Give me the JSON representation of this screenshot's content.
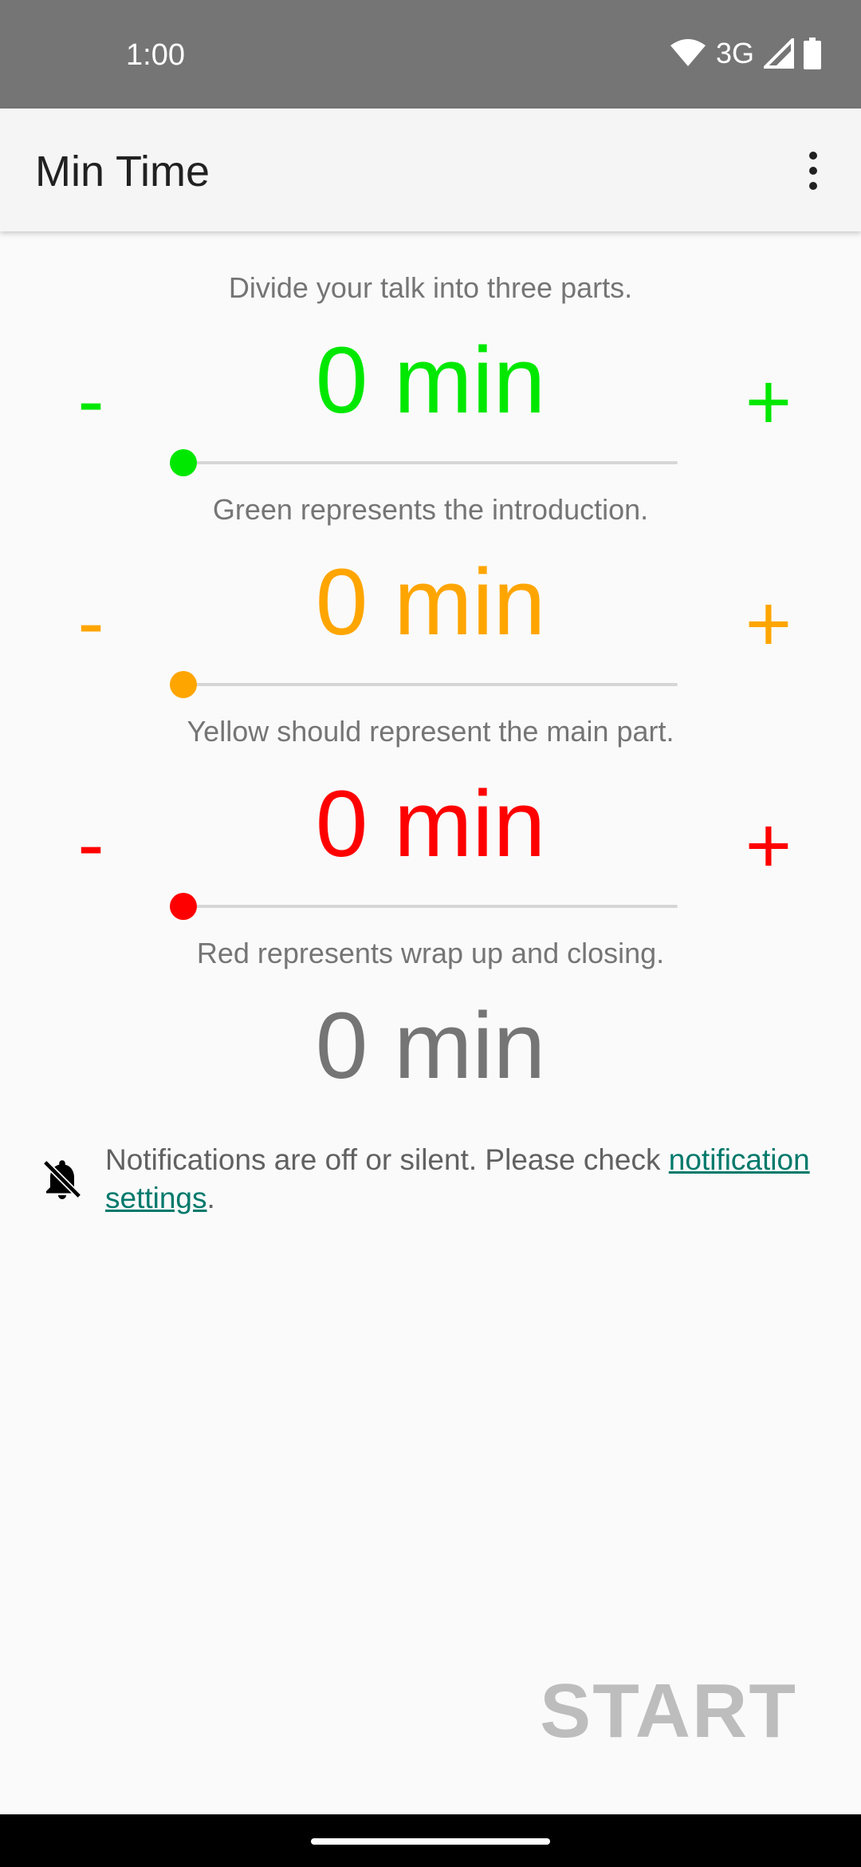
{
  "status_bar": {
    "time": "1:00",
    "network": "3G"
  },
  "app_bar": {
    "title": "Min Time"
  },
  "intro_caption": "Divide your talk into three parts.",
  "segments": [
    {
      "value": "0 min",
      "minus": "-",
      "plus": "+",
      "color": "#00e800",
      "slider_value": 0,
      "caption": "Green represents the introduction."
    },
    {
      "value": "0 min",
      "minus": "-",
      "plus": "+",
      "color": "#ffa500",
      "slider_value": 0,
      "caption": "Yellow should represent the main part."
    },
    {
      "value": "0 min",
      "minus": "-",
      "plus": "+",
      "color": "#ff0000",
      "slider_value": 0,
      "caption": "Red represents wrap up and closing."
    }
  ],
  "total": {
    "value": "0 min",
    "color": "#757575"
  },
  "notice": {
    "text": "Notifications are off or silent. Please check ",
    "link": "notification settings",
    "suffix": "."
  },
  "start_button": {
    "label": "START"
  }
}
